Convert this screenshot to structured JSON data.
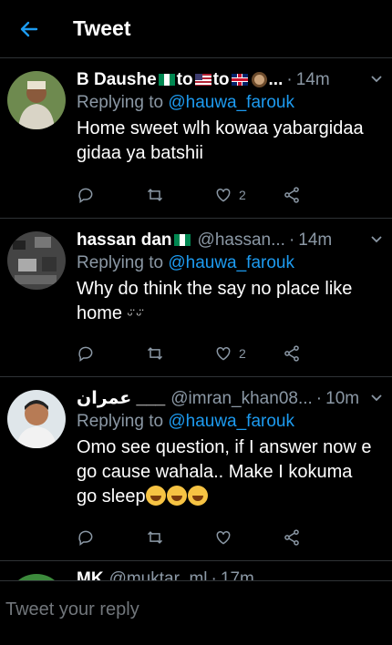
{
  "header": {
    "title": "Tweet",
    "back_icon": "arrow-left-icon"
  },
  "tweets": [
    {
      "name": "B Daushe",
      "name_flags": [
        "ng",
        "to",
        "us",
        "to",
        "uk",
        "woman"
      ],
      "name_suffix": "...",
      "handle": "",
      "time": "14m",
      "replying_prefix": "Replying to",
      "replying_to": "@hauwa_farouk",
      "text_lines": [
        "Home sweet wlh kowaa yabargidaa",
        "gidaa ya batshii"
      ],
      "likes": "2",
      "retweets": ""
    },
    {
      "name": "hassan dan",
      "handle": "@hassan...",
      "time": "14m",
      "replying_prefix": "Replying to",
      "replying_to": "@hauwa_farouk",
      "text_lines": [
        "Why do think the say no place like",
        "home"
      ],
      "likes": "2",
      "retweets": ""
    },
    {
      "name": "عمران ___",
      "handle": "@imran_khan08...",
      "time": "10m",
      "replying_prefix": "Replying to",
      "replying_to": "@hauwa_farouk",
      "text_lines": [
        "Omo see question, if I answer now e",
        "go cause wahala.. Make I kokuma",
        "go sleep"
      ],
      "likes": "",
      "retweets": ""
    }
  ],
  "partial_tweet": {
    "name": "MK",
    "handle": "@muktar_ml",
    "time": "17m"
  },
  "reply_bar": {
    "placeholder": "Tweet your reply"
  },
  "colors": {
    "background": "#000000",
    "accent": "#1d9bf0",
    "muted": "#8b98a5",
    "divider": "#2f3336"
  }
}
